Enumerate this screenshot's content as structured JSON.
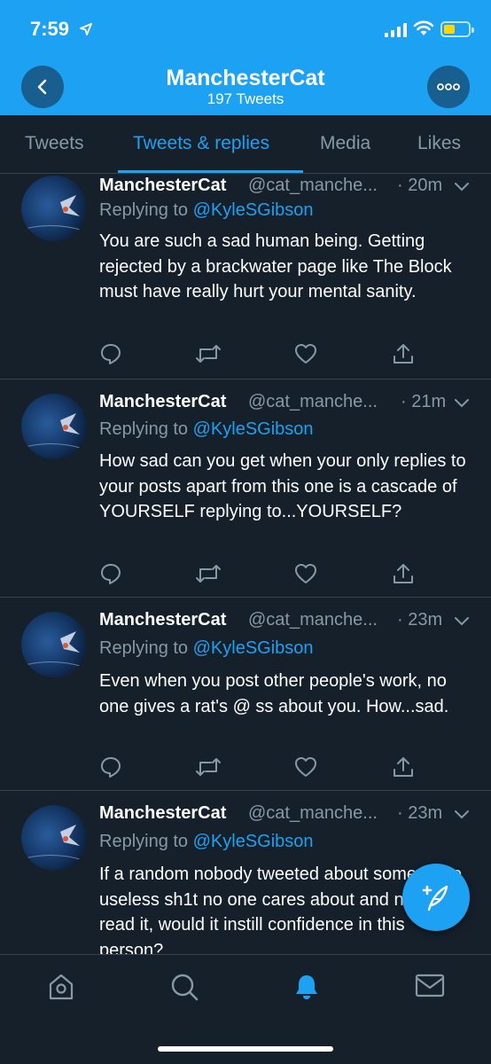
{
  "status_bar": {
    "time": "7:59"
  },
  "header": {
    "profile_name": "ManchesterCat",
    "tweet_count": "197 Tweets",
    "background_color": "#1da1f2"
  },
  "tabs": [
    {
      "label": "Tweets",
      "active": false
    },
    {
      "label": "Tweets & replies",
      "active": true
    },
    {
      "label": "Media",
      "active": false
    },
    {
      "label": "Likes",
      "active": false
    }
  ],
  "tweets": [
    {
      "name": "ManchesterCat",
      "handle": "@cat_manche...",
      "time": "· 20m",
      "replying_prefix": "Replying to ",
      "replying_to": "@KyleSGibson",
      "text": "You are such a sad human being. Getting rejected by a brackwater page like The Block must have really hurt your mental sanity."
    },
    {
      "name": "ManchesterCat",
      "handle": "@cat_manche...",
      "time": "· 21m",
      "replying_prefix": "Replying to ",
      "replying_to": "@KyleSGibson",
      "text": "How sad can you get when your only replies to your posts apart from this one is a cascade of YOURSELF replying to...YOURSELF?"
    },
    {
      "name": "ManchesterCat",
      "handle": "@cat_manche...",
      "time": "· 23m",
      "replying_prefix": "Replying to ",
      "replying_to": "@KyleSGibson",
      "text": "Even when you post other people's work, no one gives a rat's @ ss about you. How...sad."
    },
    {
      "name": "ManchesterCat",
      "handle": "@cat_manche...",
      "time": "· 23m",
      "replying_prefix": "Replying to ",
      "replying_to": "@KyleSGibson",
      "text": "If a random nobody tweeted about some more useless sh1t no one cares about and no one read it, would it instill confidence in this person?"
    }
  ],
  "icons": {
    "back": "chevron-left-icon",
    "more": "more-dots-icon",
    "reply": "reply-icon",
    "retweet": "retweet-icon",
    "like": "heart-icon",
    "share": "share-icon",
    "compose": "compose-feather-icon",
    "nav_home": "home-icon",
    "nav_search": "search-icon",
    "nav_notifications": "bell-icon",
    "nav_messages": "mail-icon"
  },
  "colors": {
    "accent": "#1da1f2",
    "background": "#15202b",
    "secondary_text": "#8899a6",
    "divider": "#38444d"
  }
}
